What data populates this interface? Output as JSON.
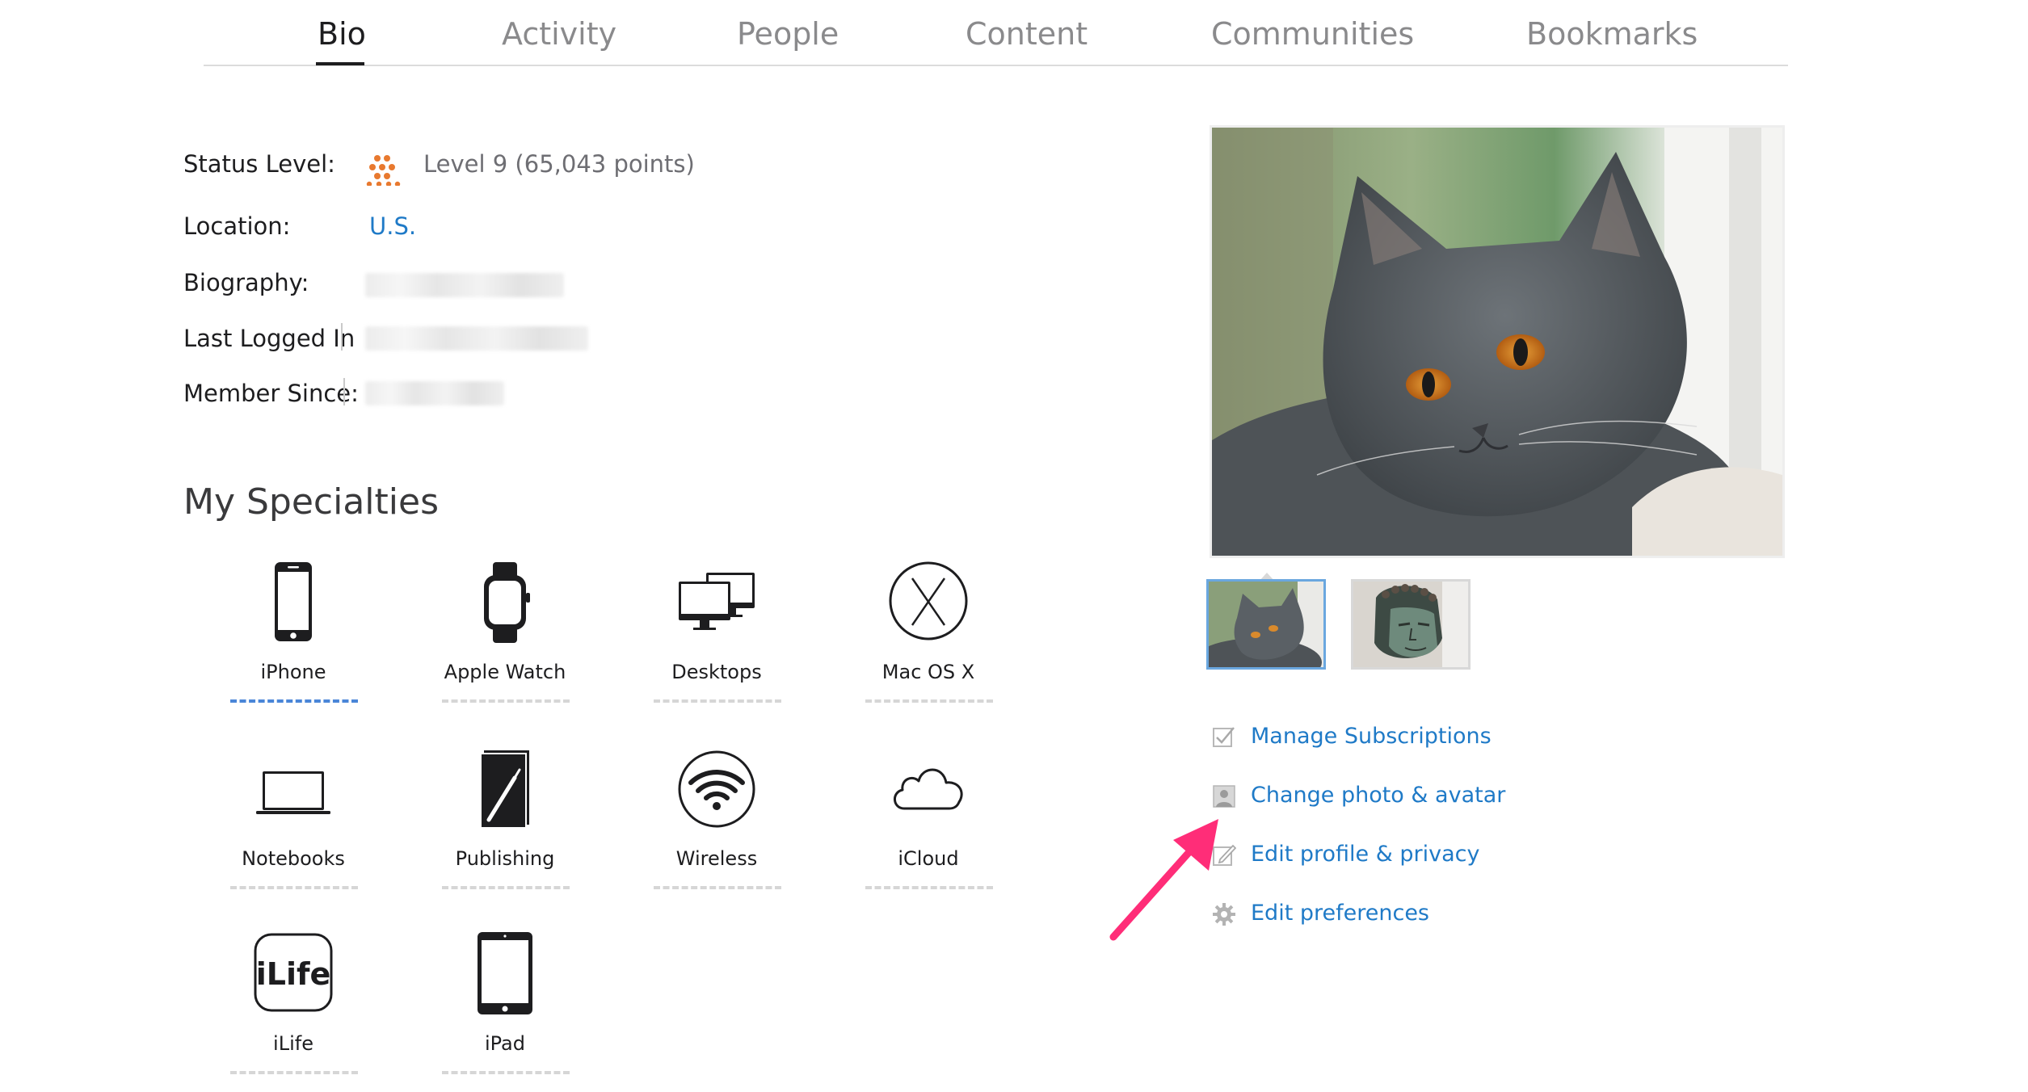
{
  "tabs": [
    {
      "label": "Bio",
      "active": true
    },
    {
      "label": "Activity",
      "active": false
    },
    {
      "label": "People",
      "active": false
    },
    {
      "label": "Content",
      "active": false
    },
    {
      "label": "Communities",
      "active": false
    },
    {
      "label": "Bookmarks",
      "active": false
    }
  ],
  "profile": {
    "status_label": "Status Level:",
    "status_value": "Level 9 (65,043 points)",
    "status_icon": "level-dots-icon",
    "location_label": "Location:",
    "location_value": "U.S.",
    "biography_label": "Biography:",
    "last_logged_label": "Last Logged In",
    "member_since_label": "Member Since:"
  },
  "specialties": {
    "title": "My Specialties",
    "items": [
      {
        "label": "iPhone",
        "icon": "iphone-icon",
        "selected": true
      },
      {
        "label": "Apple Watch",
        "icon": "apple-watch-icon",
        "selected": false
      },
      {
        "label": "Desktops",
        "icon": "desktops-icon",
        "selected": false
      },
      {
        "label": "Mac OS X",
        "icon": "mac-os-x-icon",
        "selected": false
      },
      {
        "label": "Notebooks",
        "icon": "notebook-icon",
        "selected": false
      },
      {
        "label": "Publishing",
        "icon": "publishing-icon",
        "selected": false
      },
      {
        "label": "Wireless",
        "icon": "wifi-icon",
        "selected": false
      },
      {
        "label": "iCloud",
        "icon": "cloud-icon",
        "selected": false
      },
      {
        "label": "iLife",
        "icon": "ilife-icon",
        "selected": false
      },
      {
        "label": "iPad",
        "icon": "ipad-icon",
        "selected": false
      }
    ]
  },
  "actions": [
    {
      "label": "Manage Subscriptions",
      "icon": "checkbox-icon"
    },
    {
      "label": "Change photo & avatar",
      "icon": "person-photo-icon"
    },
    {
      "label": "Edit profile & privacy",
      "icon": "edit-pencil-icon"
    },
    {
      "label": "Edit preferences",
      "icon": "gear-icon"
    }
  ],
  "colors": {
    "link": "#1f7ac7",
    "level_icon": "#e8792f",
    "selected_dash": "#4a86d8",
    "annotation_arrow": "#ff2d78"
  }
}
